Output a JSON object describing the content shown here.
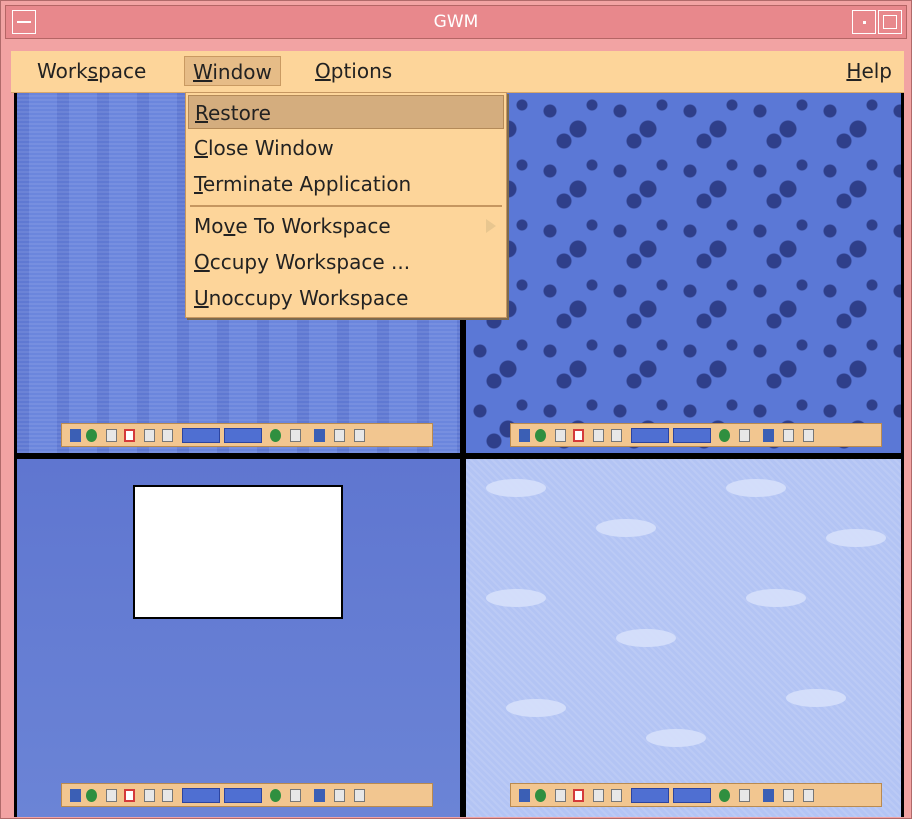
{
  "window": {
    "title": "GWM"
  },
  "menubar": {
    "workspace": {
      "pre": "Work",
      "u": "s",
      "post": "pace"
    },
    "window": {
      "pre": "",
      "u": "W",
      "post": "indow"
    },
    "options": {
      "pre": "",
      "u": "O",
      "post": "ptions"
    },
    "help": {
      "pre": "",
      "u": "H",
      "post": "elp"
    }
  },
  "window_menu": {
    "items": [
      {
        "pre": "",
        "u": "R",
        "post": "estore",
        "highlighted": true
      },
      {
        "pre": "",
        "u": "C",
        "post": "lose Window"
      },
      {
        "pre": "",
        "u": "T",
        "post": "erminate Application"
      },
      {
        "pre": "Mo",
        "u": "v",
        "post": "e To Workspace",
        "submenu": true
      },
      {
        "pre": "",
        "u": "O",
        "post": "ccupy Workspace ..."
      },
      {
        "pre": "",
        "u": "U",
        "post": "noccupy Workspace"
      }
    ]
  },
  "workspaces": [
    {
      "id": "workspace-1",
      "background": "hieroglyphs-blue"
    },
    {
      "id": "workspace-2",
      "background": "water-drops-blue"
    },
    {
      "id": "workspace-3",
      "background": "plain-blue",
      "has_window": true
    },
    {
      "id": "workspace-4",
      "background": "dolphins-light-blue"
    }
  ],
  "colors": {
    "window_frame": "#f2a3a3",
    "titlebar": "#e8888c",
    "menu_bg": "#fdd59a",
    "menu_highlight": "#d4ad7e"
  }
}
